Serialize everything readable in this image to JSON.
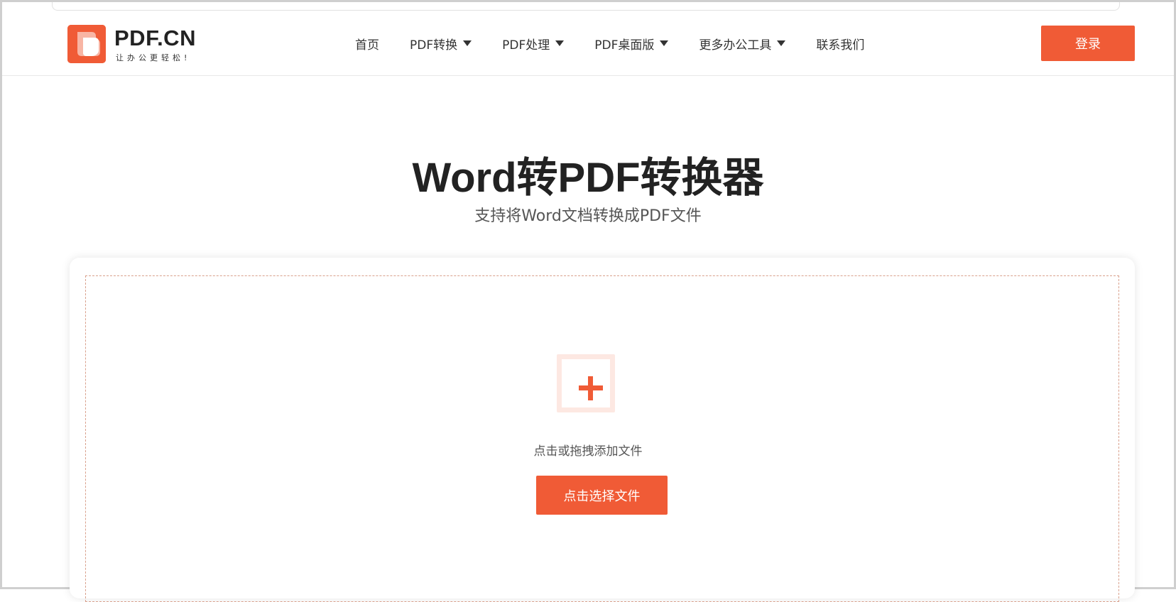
{
  "header": {
    "logo_text": "PDF.CN",
    "logo_slogan": "让办公更轻松!",
    "nav": [
      {
        "label": "首页"
      },
      {
        "label": "PDF转换"
      },
      {
        "label": "PDF处理"
      },
      {
        "label": "PDF桌面版"
      },
      {
        "label": "更多办公工具"
      },
      {
        "label": "联系我们"
      }
    ],
    "login_label": "登录"
  },
  "main": {
    "title": "Word转PDF转换器",
    "subtitle": "支持将Word文档转换成PDF文件",
    "upload": {
      "hint": "点击或拖拽添加文件",
      "button_label": "点击选择文件",
      "icon": "plus-icon"
    }
  },
  "colors": {
    "accent": "#f05b36",
    "icon_bg": "#fde8e2",
    "dash_border": "#d9a08c"
  }
}
